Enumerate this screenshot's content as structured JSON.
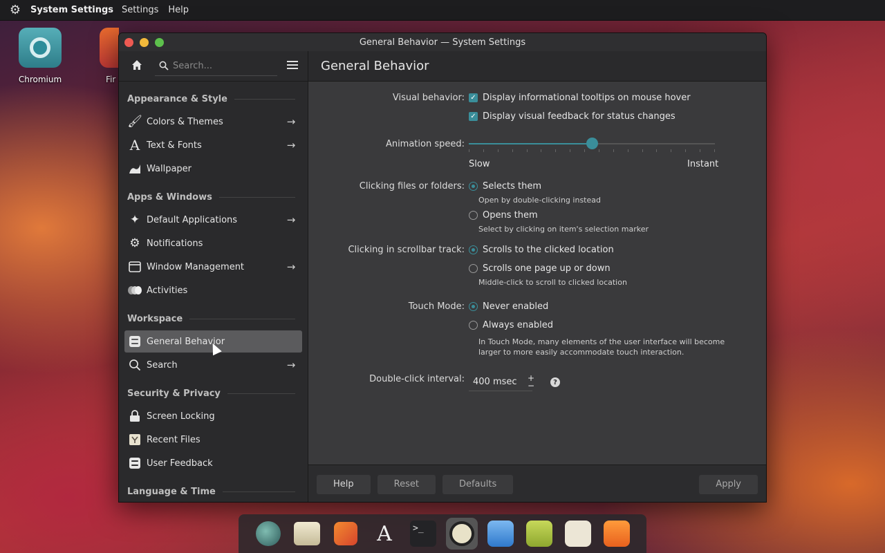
{
  "menubar": {
    "app_name": "System Settings",
    "items": [
      "Settings",
      "Help"
    ]
  },
  "desktop": {
    "icons": [
      {
        "label": "Chromium"
      },
      {
        "label": "Fir"
      }
    ]
  },
  "window": {
    "title": "General Behavior — System Settings"
  },
  "sidebar": {
    "search_placeholder": "Search...",
    "sections": [
      {
        "title": "Appearance & Style",
        "items": [
          {
            "label": "Colors & Themes",
            "icon": "brush-icon",
            "arrow": true
          },
          {
            "label": "Text & Fonts",
            "icon": "font-icon",
            "arrow": true
          },
          {
            "label": "Wallpaper",
            "icon": "wallpaper-icon",
            "arrow": false
          }
        ]
      },
      {
        "title": "Apps & Windows",
        "items": [
          {
            "label": "Default Applications",
            "icon": "sparkle-icon",
            "arrow": true
          },
          {
            "label": "Notifications",
            "icon": "notifications-icon",
            "arrow": false
          },
          {
            "label": "Window Management",
            "icon": "window-icon",
            "arrow": true
          },
          {
            "label": "Activities",
            "icon": "activities-icon",
            "arrow": false
          }
        ]
      },
      {
        "title": "Workspace",
        "items": [
          {
            "label": "General Behavior",
            "icon": "general-behavior-icon",
            "arrow": false,
            "active": true
          },
          {
            "label": "Search",
            "icon": "search-icon",
            "arrow": true
          }
        ]
      },
      {
        "title": "Security & Privacy",
        "items": [
          {
            "label": "Screen Locking",
            "icon": "lock-icon",
            "arrow": false
          },
          {
            "label": "Recent Files",
            "icon": "recent-files-icon",
            "arrow": false
          },
          {
            "label": "User Feedback",
            "icon": "feedback-icon",
            "arrow": false
          }
        ]
      },
      {
        "title": "Language & Time",
        "items": []
      }
    ]
  },
  "content": {
    "title": "General Behavior",
    "visual_behavior": {
      "label": "Visual behavior:",
      "opt1": "Display informational tooltips on mouse hover",
      "opt2": "Display visual feedback for status changes"
    },
    "animation": {
      "label": "Animation speed:",
      "min_label": "Slow",
      "max_label": "Instant",
      "value_fraction": 0.5
    },
    "clicking_files": {
      "label": "Clicking files or folders:",
      "opt1": "Selects them",
      "opt1_hint": "Open by double-clicking instead",
      "opt2": "Opens them",
      "opt2_hint": "Select by clicking on item's selection marker"
    },
    "scrollbar": {
      "label": "Clicking in scrollbar track:",
      "opt1": "Scrolls to the clicked location",
      "opt2": "Scrolls one page up or down",
      "opt2_hint": "Middle-click to scroll to clicked location"
    },
    "touch": {
      "label": "Touch Mode:",
      "opt1": "Never enabled",
      "opt2": "Always enabled",
      "hint_line1": "In Touch Mode, many elements of the user interface will become",
      "hint_line2": "larger to more easily accommodate touch interaction."
    },
    "double_click": {
      "label": "Double-click interval:",
      "value": "400 msec",
      "plus": "+",
      "minus": "−",
      "help": "?"
    },
    "footer": {
      "help": "Help",
      "reset": "Reset",
      "defaults": "Defaults",
      "apply": "Apply"
    }
  },
  "dock": {
    "items": [
      "files-icon",
      "file-manager-icon",
      "firefox-icon",
      "font-viewer-icon",
      "terminal-icon",
      "system-settings-icon",
      "document-icon",
      "spreadsheet-icon",
      "gimp-icon",
      "vlc-icon"
    ]
  }
}
